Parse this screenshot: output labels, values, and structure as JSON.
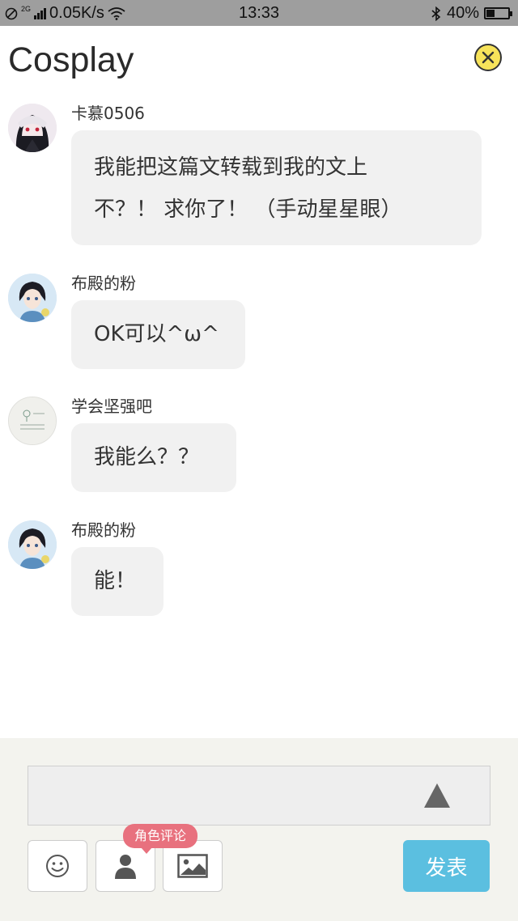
{
  "status_bar": {
    "network_type": "2G",
    "speed": "0.05K/s",
    "time": "13:33",
    "battery_percent": "40%",
    "battery_level": 0.4
  },
  "header": {
    "title": "Cosplay",
    "close_icon": "close-circle-icon",
    "close_color": "#f7e35a"
  },
  "messages": [
    {
      "username": "卡慕0506",
      "lines": [
        "我能把这篇文转载到我的文上",
        "不？！ 求你了！ （手动星星眼）"
      ],
      "avatar_icon": "anime-girl-avatar"
    },
    {
      "username": "布殿的粉",
      "lines": [
        "OK可以^ω^"
      ],
      "avatar_icon": "anime-boy-avatar"
    },
    {
      "username": "学会坚强吧",
      "lines": [
        "我能么？？"
      ],
      "avatar_icon": "text-art-avatar"
    },
    {
      "username": "布殿的粉",
      "lines": [
        "能！"
      ],
      "avatar_icon": "anime-boy-avatar"
    }
  ],
  "composer": {
    "input_value": "",
    "role_comment_badge": "角色评论",
    "publish_label": "发表",
    "icons": [
      "emoji-icon",
      "person-icon",
      "image-icon",
      "send-arrow-icon"
    ],
    "publish_color": "#5bbfe0",
    "badge_color": "#e8717e"
  }
}
